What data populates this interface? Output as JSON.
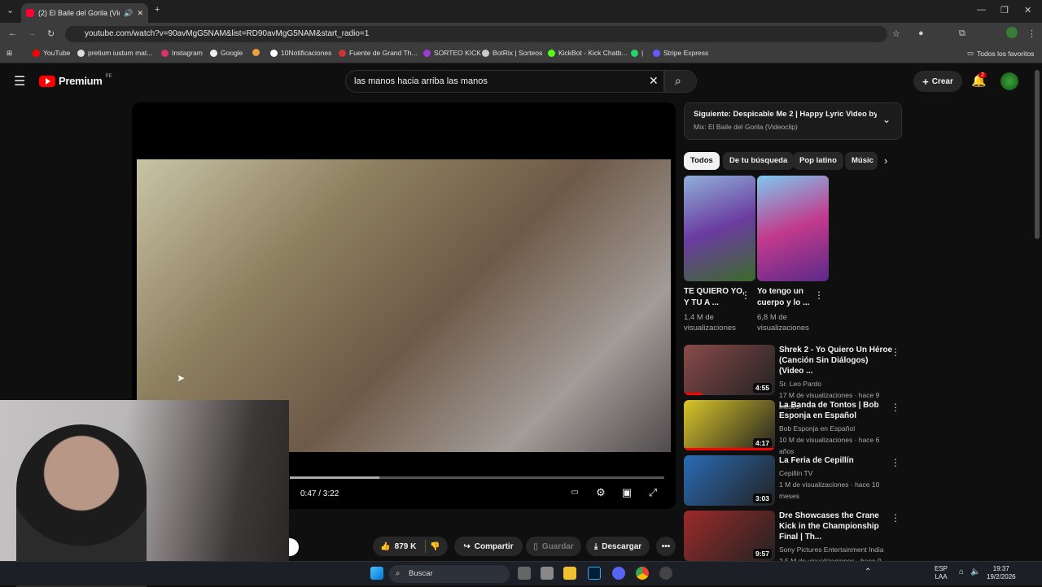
{
  "browser": {
    "tab_title": "(2) El Baile del Gorila (Video",
    "url": "youtube.com/watch?v=90avMgG5NAM&list=RD90avMgG5NAM&start_radio=1",
    "bookmarks": [
      "YouTube",
      "pretium iustum mat...",
      "Instagram",
      "Google",
      "10Notificaciones",
      "Fuente de Grand Th...",
      "SORTEO KICK",
      "BotRix | Sorteos",
      "KickBot - Kick Chatb...",
      "|",
      "Stripe Express"
    ],
    "all_bookmarks": "Todos los favoritos"
  },
  "header": {
    "logo_text": "Premium",
    "region": "PE",
    "search_value": "las manos hacia arriba las manos",
    "create_label": "Crear",
    "notifications_count": "2"
  },
  "player": {
    "time": "0:47 / 3:22",
    "progress_fraction": 0.24
  },
  "actions": {
    "likes": "879 K",
    "share": "Compartir",
    "save": "Guardar",
    "download": "Descargar"
  },
  "up_next": {
    "title": "Siguiente: Despicable Me 2 | Happy Lyric Video by ...",
    "subtitle": "Mix: El Baile del Gorila (Videoclip)"
  },
  "chips": [
    "Todos",
    "De tu búsqueda",
    "Pop latino",
    "Músic"
  ],
  "shorts": [
    {
      "title": "TE QUIERO YO, Y TU A ...",
      "views": "1,4 M de visualizaciones",
      "color": "#6a3ba0"
    },
    {
      "title": "Yo tengo un cuerpo y lo ...",
      "views": "6,8 M de visualizaciones",
      "color": "#c23a8c"
    }
  ],
  "videos": [
    {
      "title": "Shrek 2 - Yo Quiero Un Héroe (Canción Sin Diálogos) (Video ...",
      "channel": "Sr. Leo Pardo",
      "meta": "17 M de visualizaciones · hace 9 meses",
      "duration": "4:55",
      "color": "#8a4a4a",
      "progress": 0.2
    },
    {
      "title": "La Banda de Tontos | Bob Esponja en Español",
      "channel": "Bob Esponja en Español",
      "meta": "10 M de visualizaciones · hace 6 años",
      "duration": "4:17",
      "color": "#d9c52a",
      "progress": 1.0
    },
    {
      "title": "La Feria de Cepillín",
      "channel": "Cepillín TV",
      "meta": "1 M de visualizaciones · hace 10 meses",
      "duration": "3:03",
      "color": "#2a6bb5",
      "progress": 0
    },
    {
      "title": "Dre Showcases the Crane Kick in the Championship Final | Th...",
      "channel": "Sony Pictures Entertainment India",
      "meta": "2,5 M de visualizaciones · hace 9 meses",
      "duration": "9:57",
      "color": "#9c2a2a",
      "progress": 0
    }
  ],
  "taskbar": {
    "search": "Buscar",
    "lang_top": "ESP",
    "lang_bottom": "LAA",
    "time": "19:37",
    "date": "19/2/2026"
  }
}
